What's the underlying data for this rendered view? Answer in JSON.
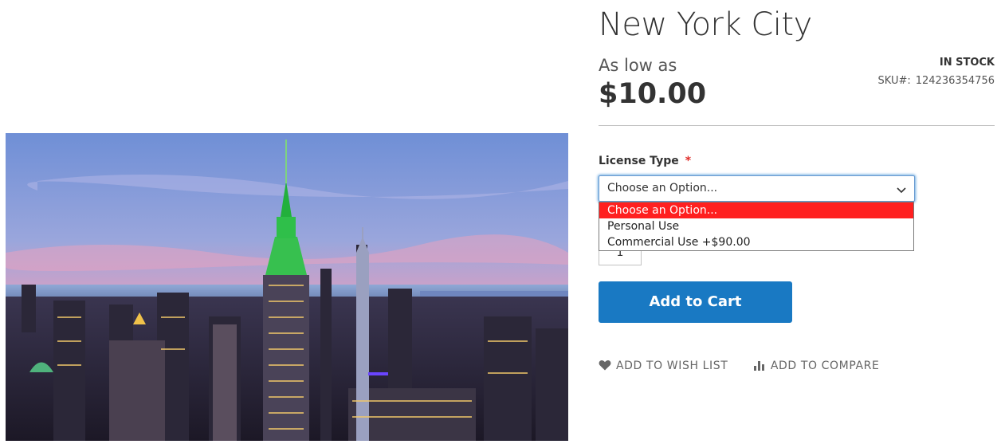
{
  "product": {
    "title": "New York City",
    "price_prefix": "As low as",
    "price": "$10.00",
    "stock_status": "IN STOCK",
    "sku_label": "SKU#:",
    "sku_value": "124236354756",
    "image_icon": "photo-of-new-york-skyline-at-dusk"
  },
  "options": {
    "label": "License Type",
    "required_mark": "*",
    "selected": "Choose an Option...",
    "dropdown_open": true,
    "items": [
      {
        "label": "Choose an Option...",
        "highlighted": true
      },
      {
        "label": "Personal Use",
        "highlighted": false
      },
      {
        "label": "Commercial Use +$90.00",
        "highlighted": false
      }
    ]
  },
  "quantity": {
    "value": "1"
  },
  "buttons": {
    "add_to_cart": "Add to Cart",
    "wish_list": "ADD TO WISH LIST",
    "compare": "ADD TO COMPARE"
  },
  "colors": {
    "primary_button": "#1979c3",
    "highlight_option": "#ff2020",
    "required_star": "#e02b27"
  }
}
